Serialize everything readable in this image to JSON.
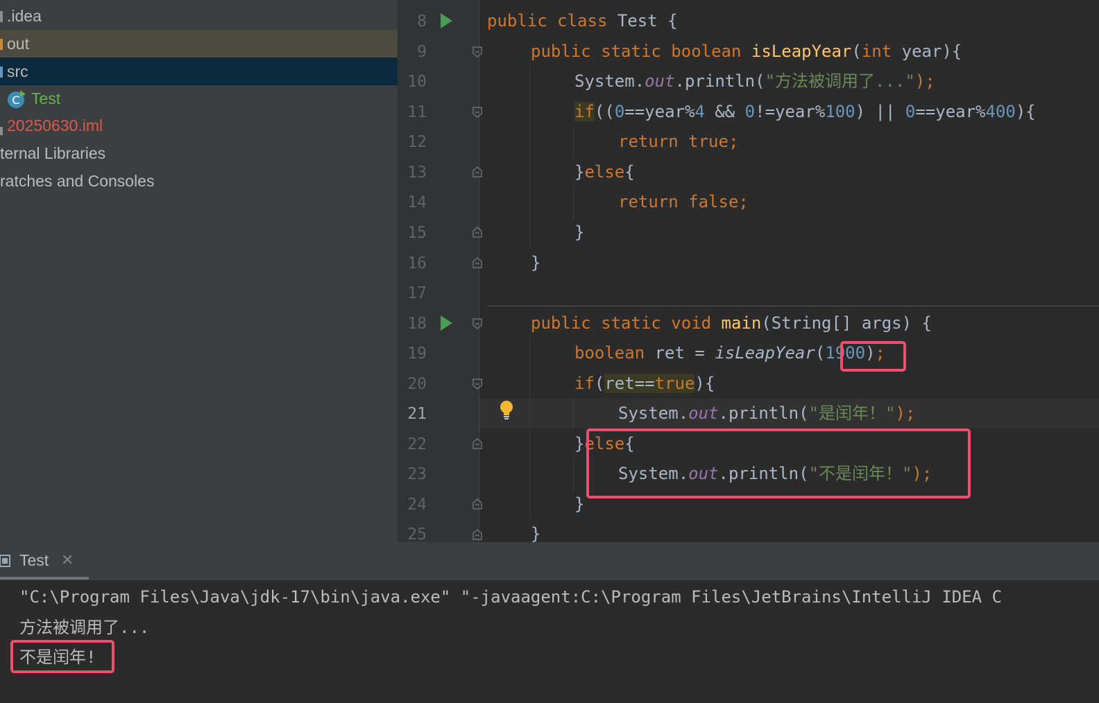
{
  "project_tree": {
    "items": [
      {
        "label": ".idea",
        "color": "#bbbbbb"
      },
      {
        "label": "out",
        "color": "#bbbbbb"
      },
      {
        "label": "src",
        "color": "#bbbbbb"
      },
      {
        "label": "Test",
        "color": "#62b543"
      },
      {
        "label": "20250630.iml",
        "color": "#d9594c"
      },
      {
        "label": "ternal Libraries",
        "color": "#bbbbbb"
      },
      {
        "label": "ratches and Consoles",
        "color": "#bbbbbb"
      }
    ]
  },
  "editor": {
    "line_numbers": [
      "8",
      "9",
      "10",
      "11",
      "12",
      "13",
      "14",
      "15",
      "16",
      "17",
      "18",
      "19",
      "20",
      "21",
      "22",
      "23",
      "24",
      "25"
    ],
    "active_line": "21",
    "code": {
      "l8": {
        "kw1": "public class ",
        "rest": "Test {"
      },
      "l9": {
        "kw1": "public static boolean ",
        "fn": "isLeapYear",
        "p1": "(",
        "kw2": "int",
        "p2": " year){"
      },
      "l10": {
        "a": "System.",
        "fld": "out",
        "b": ".println(",
        "str": "\"方法被调用了...\"",
        "c": ");"
      },
      "l11": {
        "kw": "if",
        "a": "((",
        "n1": "0",
        "b": "==year%",
        "n2": "4",
        "c": " && ",
        "n3": "0",
        "d": "!=year%",
        "n4": "100",
        "e": ") || ",
        "n5": "0",
        "f": "==year%",
        "n6": "400",
        "g": "){"
      },
      "l12": {
        "kw": "return true;"
      },
      "l13": {
        "a": "}",
        "kw": "else",
        "b": "{"
      },
      "l14": {
        "kw": "return false;"
      },
      "l15": {
        "a": "}"
      },
      "l16": {
        "a": "}"
      },
      "l18": {
        "kw1": "public static void ",
        "fn": "main",
        "a": "(String[] args) {"
      },
      "l19": {
        "kw": "boolean",
        "a": " ret = ",
        "it": "isLeapYear",
        "b": "(",
        "n": "1900",
        "c": ")",
        "d": ";"
      },
      "l20": {
        "kw": "if",
        "a": "(",
        "h1": "ret==",
        "h2": "true",
        "b": "){"
      },
      "l21": {
        "a": "System.",
        "fld": "out",
        "b": ".println(",
        "str": "\"是闰年！\"",
        "c": ");"
      },
      "l22": {
        "a": "}",
        "kw": "else",
        "b": "{"
      },
      "l23": {
        "a": "System.",
        "fld": "out",
        "b": ".println(",
        "str": "\"不是闰年！\"",
        "c": ");"
      },
      "l24": {
        "a": "}"
      },
      "l25": {
        "a": "}"
      }
    }
  },
  "run_panel": {
    "tab_label": "Test",
    "tab_close": "✕",
    "console_lines": [
      "\"C:\\Program Files\\Java\\jdk-17\\bin\\java.exe\" \"-javaagent:C:\\Program Files\\JetBrains\\IntelliJ IDEA C",
      "方法被调用了...",
      "不是闰年!"
    ]
  },
  "colors": {
    "keyword": "#cc7832",
    "function": "#ffc66d",
    "number": "#6897bb",
    "string": "#6a8759",
    "field": "#9876aa",
    "annotation_box": "#f0506e"
  }
}
